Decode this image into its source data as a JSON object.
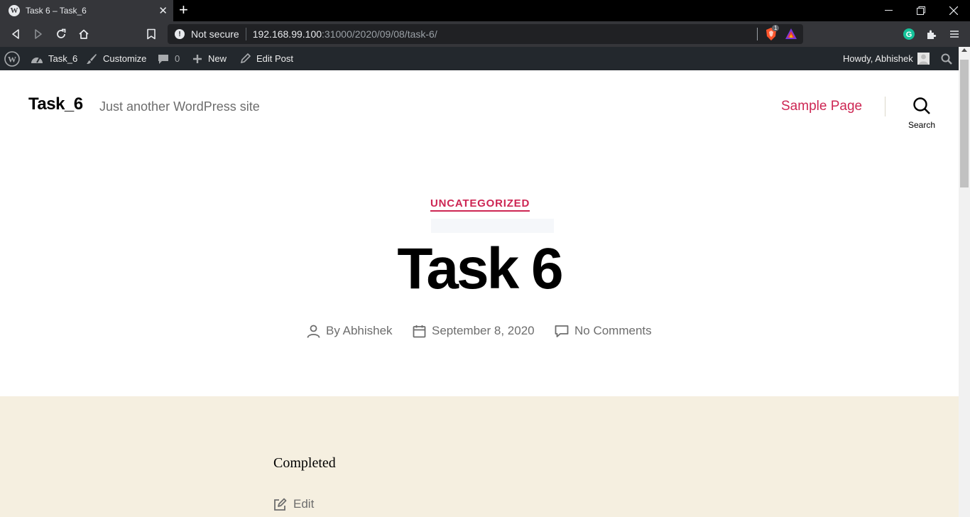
{
  "browser": {
    "tab_title": "Task 6 – Task_6",
    "tab_favicon": "W",
    "new_tab": "+",
    "not_secure": "Not secure",
    "url_host": "192.168.99.100",
    "url_path": ":31000/2020/09/08/task-6/",
    "brave_badge": "1"
  },
  "admin_bar": {
    "site_name": "Task_6",
    "customize": "Customize",
    "comments_count": "0",
    "new": "New",
    "edit_post": "Edit Post",
    "greeting": "Howdy, Abhishek"
  },
  "site": {
    "title": "Task_6",
    "description": "Just another WordPress site",
    "nav": [
      "Sample Page"
    ],
    "search_label": "Search",
    "link_color": "#cd2653"
  },
  "post": {
    "category": "UNCATEGORIZED",
    "title": "Task 6",
    "author": "By Abhishek",
    "date": "September 8, 2020",
    "comments": "No Comments",
    "content": "Completed",
    "edit_label": "Edit"
  }
}
